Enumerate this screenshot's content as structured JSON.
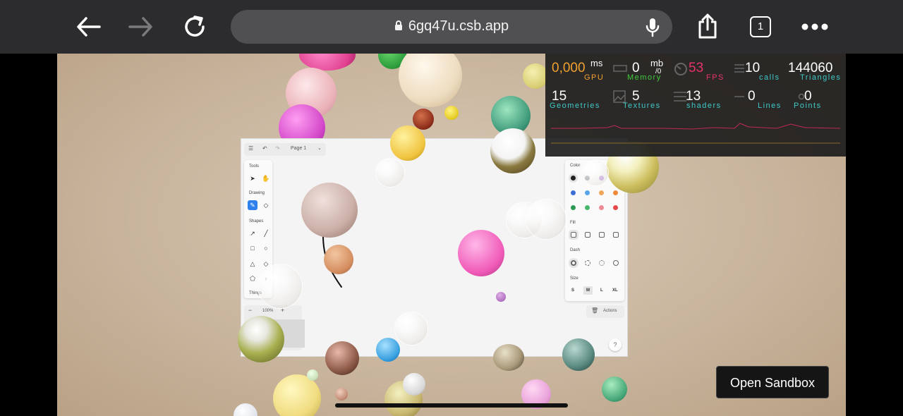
{
  "browser": {
    "url": "6gq47u.csb.app",
    "tab_count": "1"
  },
  "app": {
    "page_label": "Page 1",
    "tools_label": "Tools",
    "drawing_label": "Drawing",
    "shapes_label": "Shapes",
    "things_label": "Things",
    "zoom_value": "100%",
    "style": {
      "color_label": "Color",
      "fill_label": "Fill",
      "dash_label": "Dash",
      "size_label": "Size",
      "sizes": [
        "S",
        "M",
        "L",
        "XL"
      ],
      "selected_size": "M",
      "swatches": [
        "#222222",
        "#9aa0a6",
        "#c9a6e0",
        "#d291e8",
        "#3f6fd6",
        "#58a6e8",
        "#f0a75a",
        "#ee8a3a",
        "#2b9a55",
        "#48b86a",
        "#ee8a95",
        "#e54848"
      ]
    },
    "actions_label": "Actions",
    "help_label": "?"
  },
  "stats": {
    "gpu": {
      "value": "0,000",
      "unit": "ms",
      "name": "GPU"
    },
    "memory": {
      "value": "0",
      "unit": "mb",
      "sub": "/0",
      "name": "Memory"
    },
    "fps": {
      "value": "53",
      "name": "FPS"
    },
    "calls": {
      "value": "10",
      "name": "calls"
    },
    "triangles": {
      "value": "144060",
      "name": "Triangles"
    },
    "geometries": {
      "value": "15",
      "name": "Geometries"
    },
    "textures": {
      "value": "5",
      "name": "Textures"
    },
    "shaders": {
      "value": "13",
      "name": "shaders"
    },
    "lines": {
      "value": "0",
      "name": "Lines"
    },
    "points": {
      "value": "0",
      "name": "Points"
    },
    "colors": {
      "gpu": "#f0a030",
      "memory": "#3ec93e",
      "fps": "#e8336a",
      "calls": "#3ec9c9",
      "label_teal": "#3ec9c9",
      "label_green": "#3ec93e",
      "label_pink": "#e8336a",
      "label_orange": "#f0a030"
    }
  },
  "open_sandbox_label": "Open Sandbox"
}
